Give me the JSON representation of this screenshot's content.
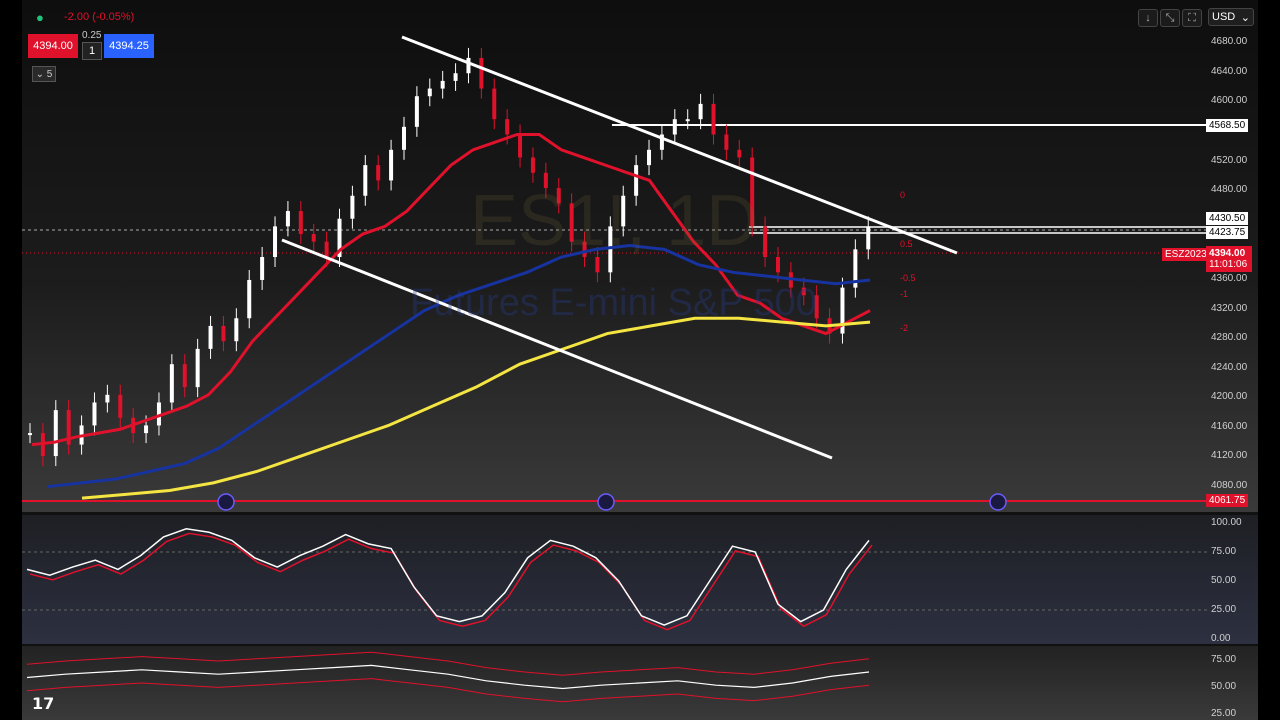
{
  "header": {
    "change": "-2.00 (-0.05%)",
    "sell_price": "4394.00",
    "spread": "0.25",
    "qty": "1",
    "buy_price": "4394.25",
    "indicators_toggle": "5"
  },
  "toolbar": {
    "currency": "USD"
  },
  "watermark": {
    "symbol": "ES1!, 1D",
    "name": "Futures E-mini S&P 500"
  },
  "colors": {
    "up": "#ffffff",
    "down": "#e0112b",
    "ema_fast": "#e0112b",
    "ema_mid": "#1733a0",
    "ema_slow": "#f4e542",
    "accent": "#2962ff"
  },
  "price_axis": [
    "4680.00",
    "4640.00",
    "4600.00",
    "4568.50",
    "4520.00",
    "4480.00",
    "4430.50",
    "4423.75",
    "4360.00",
    "4320.00",
    "4280.00",
    "4240.00",
    "4200.00",
    "4160.00",
    "4120.00",
    "4080.00"
  ],
  "price_tags": {
    "symbol": "ESZ2023",
    "last": "4394.00",
    "countdown": "11:01:06",
    "level_low": "4061.75",
    "level_high": "4568.50",
    "level_a": "4430.50",
    "level_b": "4423.75"
  },
  "fib_labels": [
    "0",
    "0.5",
    "-0.5",
    "-1",
    "-2"
  ],
  "osc1_axis": [
    "100.00",
    "75.00",
    "50.00",
    "25.00",
    "0.00"
  ],
  "osc2_axis": [
    "75.00",
    "50.00",
    "25.00"
  ],
  "icons": {
    "logo": "tradingview-logo-icon",
    "arrow": "down-arrow-icon",
    "fullscreen": "fullscreen-icon",
    "snapshot": "camera-icon",
    "replay": "replay-jump-icon"
  },
  "chart_data": {
    "type": "candlestick",
    "ylim": [
      4060,
      4700
    ],
    "closes": [
      4150,
      4120,
      4180,
      4135,
      4160,
      4190,
      4200,
      4170,
      4150,
      4160,
      4190,
      4240,
      4210,
      4260,
      4290,
      4270,
      4300,
      4350,
      4380,
      4420,
      4440,
      4410,
      4400,
      4380,
      4430,
      4460,
      4500,
      4480,
      4520,
      4550,
      4590,
      4600,
      4610,
      4620,
      4640,
      4600,
      4560,
      4540,
      4510,
      4490,
      4470,
      4450,
      4400,
      4380,
      4360,
      4420,
      4460,
      4500,
      4520,
      4540,
      4560,
      4560,
      4580,
      4540,
      4520,
      4510,
      4420,
      4380,
      4360,
      4340,
      4330,
      4300,
      4280,
      4340,
      4390,
      4420,
      4380,
      4340,
      4300,
      4290,
      4280,
      4240,
      4200,
      4180,
      4150,
      4280,
      4340,
      4380,
      4394
    ],
    "ema_fast": [
      4135,
      4138,
      4145,
      4150,
      4155,
      4165,
      4175,
      4185,
      4200,
      4230,
      4270,
      4300,
      4330,
      4360,
      4390,
      4410,
      4420,
      4440,
      4470,
      4500,
      4520,
      4530,
      4540,
      4540,
      4520,
      4510,
      4500,
      4490,
      4480,
      4440,
      4400,
      4370,
      4330,
      4320,
      4300,
      4290,
      4280,
      4295,
      4310
    ],
    "ema_mid": [
      4080,
      4085,
      4090,
      4100,
      4110,
      4130,
      4160,
      4190,
      4220,
      4250,
      4280,
      4310,
      4330,
      4345,
      4360,
      4380,
      4390,
      4395,
      4390,
      4370,
      4360,
      4355,
      4350,
      4345,
      4350
    ],
    "ema_slow": [
      4065,
      4070,
      4075,
      4085,
      4100,
      4120,
      4140,
      4160,
      4185,
      4210,
      4240,
      4260,
      4280,
      4290,
      4300,
      4300,
      4295,
      4290,
      4295
    ],
    "osc1_fast": [
      60,
      55,
      62,
      68,
      60,
      72,
      88,
      95,
      92,
      85,
      70,
      62,
      72,
      80,
      90,
      82,
      78,
      45,
      20,
      15,
      20,
      40,
      70,
      85,
      80,
      70,
      50,
      20,
      12,
      20,
      50,
      80,
      75,
      30,
      15,
      25,
      60,
      85
    ],
    "osc2_mid": [
      55,
      58,
      60,
      62,
      60,
      58,
      60,
      62,
      64,
      66,
      62,
      58,
      52,
      48,
      45,
      48,
      50,
      52,
      48,
      46,
      50,
      56,
      60
    ]
  }
}
